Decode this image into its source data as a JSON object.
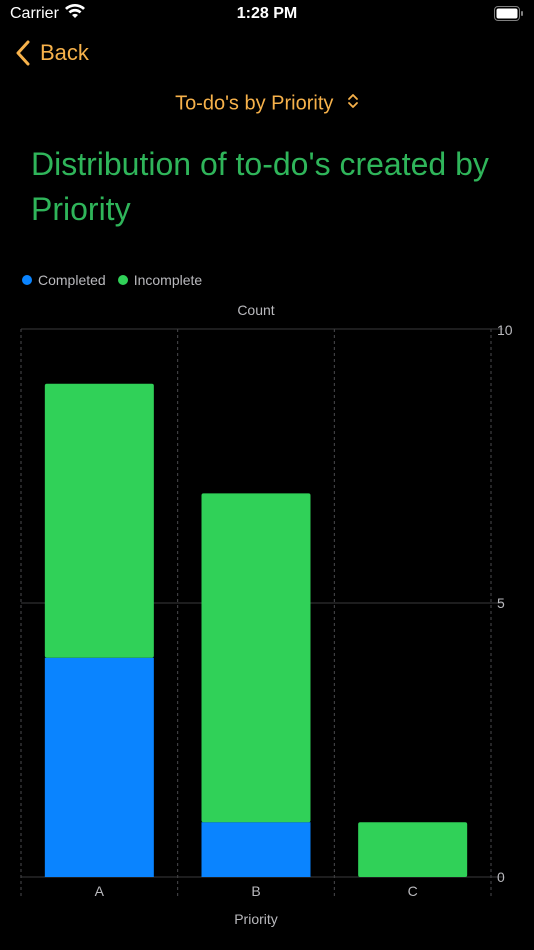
{
  "status_bar": {
    "carrier": "Carrier",
    "time": "1:28 PM"
  },
  "nav": {
    "back_label": "Back"
  },
  "picker": {
    "label": "To-do's by Priority"
  },
  "heading": {
    "title": "Distribution of to-do's created by Priority"
  },
  "colors": {
    "accent": "#f7b24b",
    "title": "#2fb55a",
    "completed": "#0a84ff",
    "incomplete": "#30d158"
  },
  "chart_data": {
    "type": "bar",
    "stacked": true,
    "categories": [
      "A",
      "B",
      "C"
    ],
    "series": [
      {
        "name": "Completed",
        "values": [
          4,
          1,
          0
        ]
      },
      {
        "name": "Incomplete",
        "values": [
          5,
          6,
          1
        ]
      }
    ],
    "xlabel": "Priority",
    "ylabel": "Count",
    "ylim": [
      0,
      10
    ],
    "yticks": [
      0,
      5,
      10
    ],
    "legend_position": "top-left",
    "grid": true
  }
}
